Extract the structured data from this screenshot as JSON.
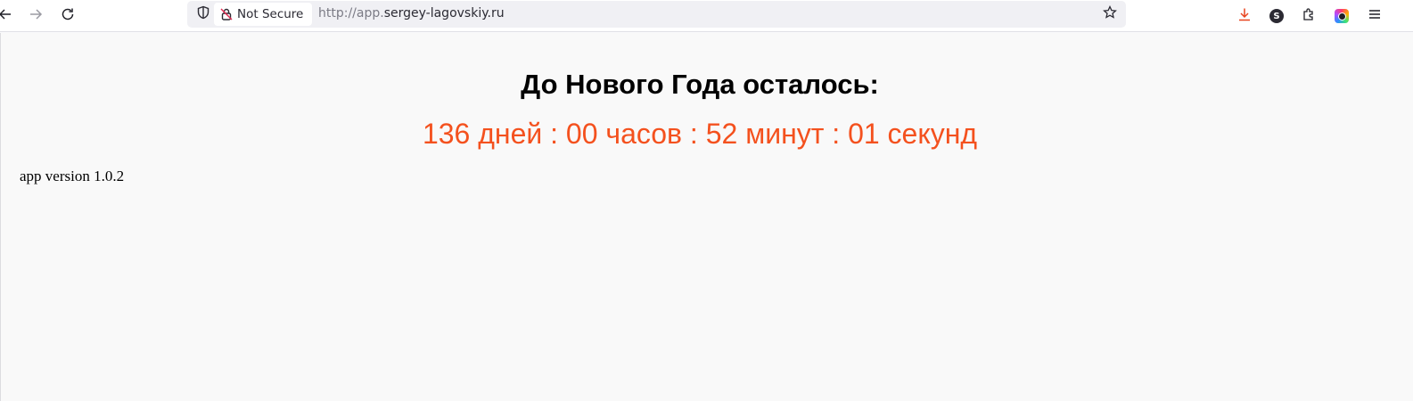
{
  "browser": {
    "security_label": "Not Secure",
    "url_prefix": "http://app.",
    "url_domain": "sergey-lagovskiy.ru",
    "account_initial": "S",
    "icons": [
      "back-icon",
      "forward-icon",
      "reload-icon",
      "shield-icon",
      "insecure-lock-icon",
      "bookmark-star-icon",
      "download-icon",
      "account-icon",
      "extensions-icon",
      "colorful-extension-icon",
      "menu-icon"
    ],
    "accent_download": "#e8441e"
  },
  "page": {
    "heading": "До Нового Года осталось:",
    "countdown": "136 дней : 00 часов : 52 минут : 01 секунд",
    "version": "app version 1.0.2",
    "countdown_color": "#f4511e"
  }
}
